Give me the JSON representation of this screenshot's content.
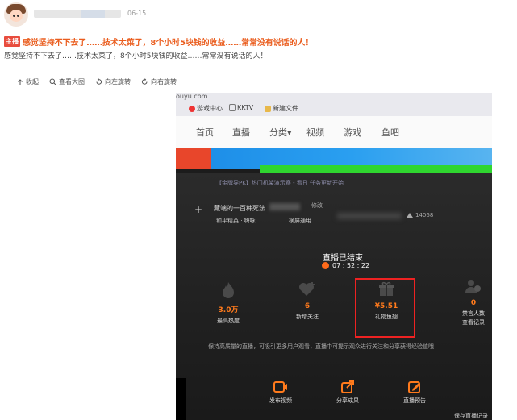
{
  "post": {
    "date": "06-15",
    "badge": "主播",
    "title": "感觉坚持不下去了……技术太菜了，8个小时5块钱的收益……常常没有说话的人！",
    "body": "感觉坚持不下去了……技术太菜了，8个小时5块钱的收益……常常没有说话的人！"
  },
  "toolbar": {
    "collapse": "收起",
    "view_large": "查看大图",
    "rotate_left": "向左旋转",
    "rotate_right": "向右旋转"
  },
  "photo": {
    "url_fragment": "ouyu.com",
    "bookmarks": [
      "游戏中心",
      "KKTV",
      "新建文件"
    ],
    "nav": [
      "首页",
      "直播",
      "分类▾",
      "视频",
      "游戏",
      "鱼吧"
    ],
    "notice": "【金牌导PK】热门机架演示赛 - 看日 任务更新开始",
    "room_name": "藏端的一百种死法",
    "edit": "修改",
    "category": "和平精英 · 嗨咏",
    "quality": "横屏通用",
    "viewers": "14068",
    "ended": "直播已结束",
    "duration": "07 : 52 : 22",
    "stats": [
      {
        "value": "3.0万",
        "label": "最高热度"
      },
      {
        "value": "6",
        "label": "新增关注"
      },
      {
        "value": "¥5.51",
        "label": "礼物鱼翅"
      },
      {
        "value": "0",
        "label": "禁言人数",
        "label2": "查看记录"
      }
    ],
    "tip": "保持高质量的直播，可吸引更多用户观看，直播中可提示观众进行关注和分享获得经验值哦",
    "buttons": [
      "发布视频",
      "分享成果",
      "直播预告"
    ],
    "bottom_right": "保存直播记录"
  },
  "colors": {
    "badge_bg": "#e84c3d",
    "title_orange": "#ea5d1e",
    "stat_orange": "#ff7a1c",
    "highlight_red": "#e22222"
  }
}
